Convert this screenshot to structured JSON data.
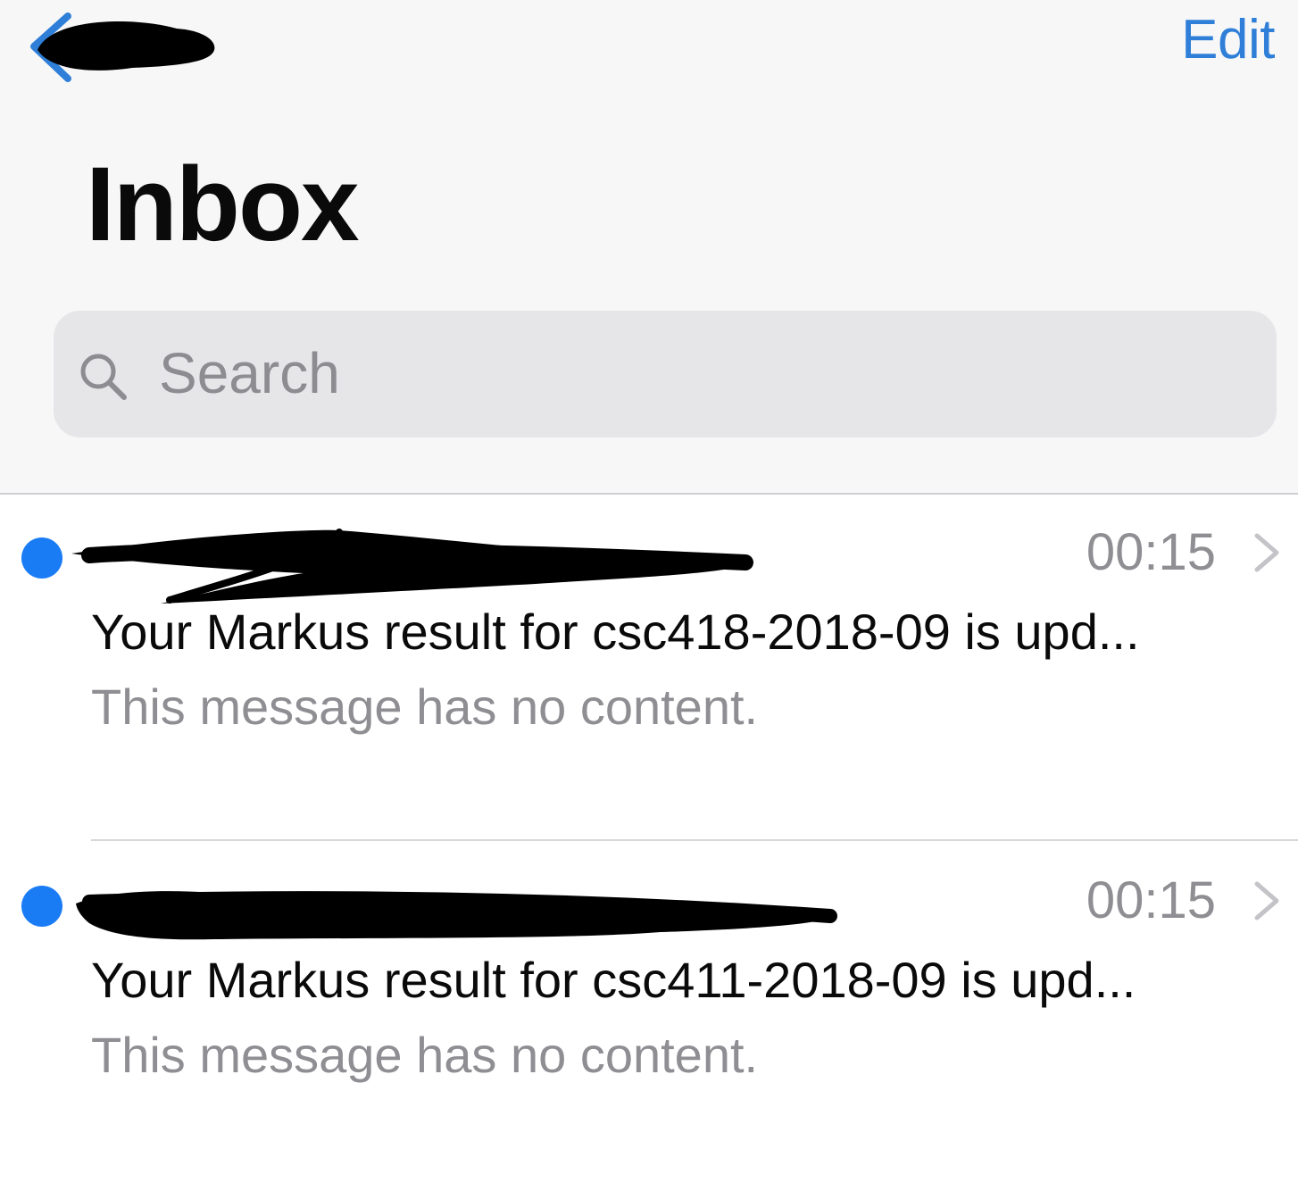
{
  "nav": {
    "edit_label": "Edit"
  },
  "header": {
    "title": "Inbox"
  },
  "search": {
    "placeholder": "Search"
  },
  "messages": [
    {
      "time": "00:15",
      "subject": "Your Markus result for csc418-2018-09 is upd...",
      "preview": "This message has no content.",
      "unread": true
    },
    {
      "time": "00:15",
      "subject": "Your Markus result for csc411-2018-09 is upd...",
      "preview": "This message has no content.",
      "unread": true
    }
  ],
  "colors": {
    "accent": "#2f7fd8",
    "unread_dot": "#1a7cf5",
    "secondary_text": "#8e8e93",
    "header_background": "#f7f7f8"
  }
}
